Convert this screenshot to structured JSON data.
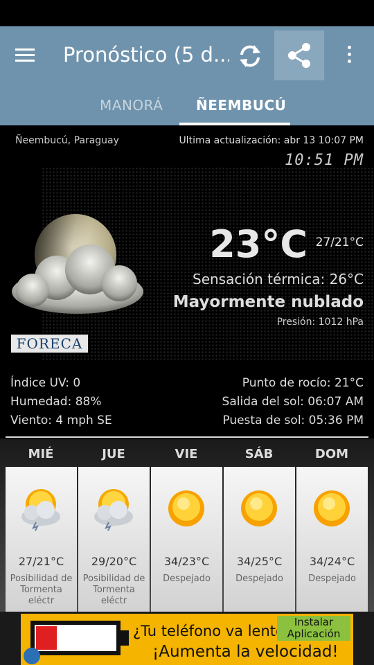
{
  "app": {
    "title": "Pronóstico (5 d...",
    "icons": {
      "menu": "hamburger-icon",
      "refresh": "refresh-icon",
      "share": "share-icon",
      "more": "more-vert-icon"
    },
    "colors": {
      "appbar": "#6f93ad",
      "share_pressed": "#8aa8bd"
    }
  },
  "tabs": [
    {
      "label": "MANORÁ",
      "selected": false
    },
    {
      "label": "ÑEEMBUCÚ",
      "selected": true
    }
  ],
  "current": {
    "location": "Ñeembucú, Paraguay",
    "updated": "Ultima actualización: abr 13  10:07 PM",
    "clock": "10:51 PM",
    "temperature": "23°C",
    "high_low": "27/21°C",
    "feels_like": "Sensación térmica: 26°C",
    "condition": "Mayormente nublado",
    "pressure": "Presión: 1012 hPa",
    "provider_logo": "FORECA",
    "stats_left": [
      "Índice UV: 0",
      "Humedad: 88%",
      "Viento: 4 mph SE"
    ],
    "stats_right": [
      "Punto de rocío: 21°C",
      "Salida del sol: 06:07 AM",
      "Puesta de sol: 05:36 PM"
    ]
  },
  "forecast": [
    {
      "day": "MIÉ",
      "range": "27/21°C",
      "desc": "Posibilidad de Tormenta eléctr",
      "icon": "sun-storm-cloud-icon"
    },
    {
      "day": "JUE",
      "range": "29/20°C",
      "desc": "Posibilidad de Tormenta eléctr",
      "icon": "sun-storm-cloud-icon"
    },
    {
      "day": "VIE",
      "range": "34/23°C",
      "desc": "Despejado",
      "icon": "sun-icon"
    },
    {
      "day": "SÁB",
      "range": "34/25°C",
      "desc": "Despejado",
      "icon": "sun-icon"
    },
    {
      "day": "DOM",
      "range": "34/24°C",
      "desc": "Despejado",
      "icon": "sun-icon"
    }
  ],
  "ad": {
    "line1": "¿Tu teléfono va lento?",
    "line2": "¡Aumenta la velocidad!",
    "install": "Instalar Aplicación",
    "colors": {
      "banner": "#f5b400",
      "install": "#8bc13f",
      "battery_low": "#e02020"
    }
  }
}
